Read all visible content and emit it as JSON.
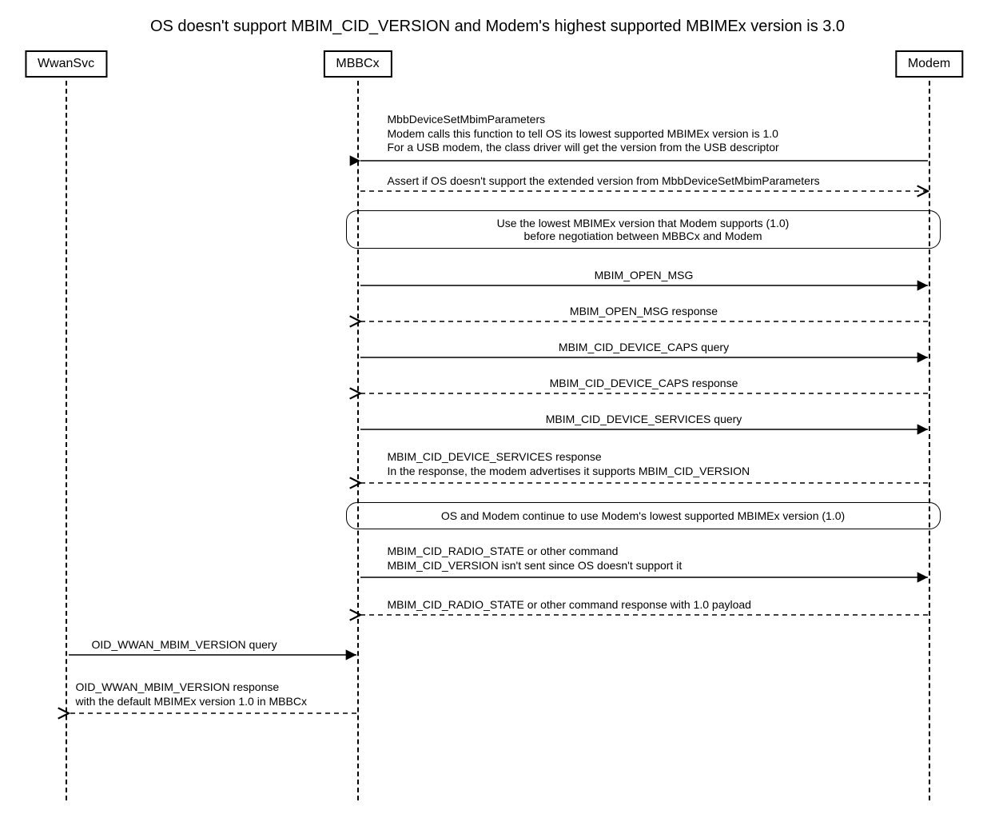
{
  "title": "OS doesn't support MBIM_CID_VERSION and Modem's highest supported MBIMEx version is 3.0",
  "actors": {
    "wwansvc": "WwanSvc",
    "mbbcx": "MBBCx",
    "modem": "Modem"
  },
  "messages": {
    "m1_l1": "MbbDeviceSetMbimParameters",
    "m1_l2": "Modem calls this function to tell OS its lowest supported MBIMEx version is 1.0",
    "m1_l3": "For a USB modem, the class driver will get the version from the USB descriptor",
    "m2": "Assert if OS doesn't support the extended version from MbbDeviceSetMbimParameters",
    "note1_l1": "Use the lowest MBIMEx version that Modem supports (1.0)",
    "note1_l2": "before negotiation between MBBCx and Modem",
    "m3": "MBIM_OPEN_MSG",
    "m4": "MBIM_OPEN_MSG response",
    "m5": "MBIM_CID_DEVICE_CAPS query",
    "m6": "MBIM_CID_DEVICE_CAPS response",
    "m7": "MBIM_CID_DEVICE_SERVICES query",
    "m8_l1": "MBIM_CID_DEVICE_SERVICES response",
    "m8_l2": "In the response, the modem advertises it supports MBIM_CID_VERSION",
    "note2": "OS and Modem continue to use Modem's lowest supported MBIMEx version (1.0)",
    "m9_l1": "MBIM_CID_RADIO_STATE or other command",
    "m9_l2": "MBIM_CID_VERSION isn't sent since OS doesn't support it",
    "m10": "MBIM_CID_RADIO_STATE or other command response with 1.0 payload",
    "m11": "OID_WWAN_MBIM_VERSION query",
    "m12_l1": "OID_WWAN_MBIM_VERSION response",
    "m12_l2": "with the default MBIMEx version 1.0 in MBBCx"
  }
}
